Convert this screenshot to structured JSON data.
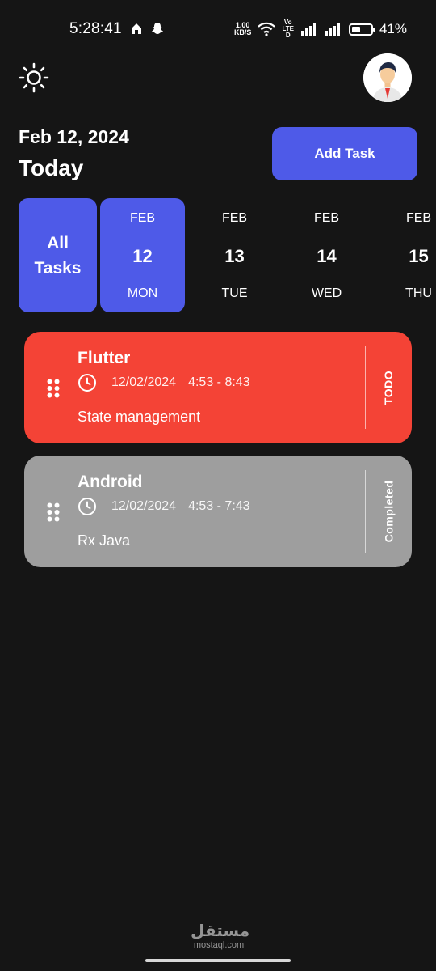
{
  "status_bar": {
    "time": "5:28:41",
    "net_speed_value": "1.00",
    "net_speed_unit": "KB/S",
    "volte_top": "Vo",
    "volte_mid": "LTE",
    "volte_bot": "D",
    "battery_percent": "41%",
    "battery_level": 0.41
  },
  "header": {
    "date": "Feb 12, 2024",
    "today": "Today",
    "add_task_label": "Add Task"
  },
  "date_strip": {
    "all_tasks_line1": "All",
    "all_tasks_line2": "Tasks",
    "days": [
      {
        "month": "FEB",
        "day": "12",
        "weekday": "MON",
        "selected": true
      },
      {
        "month": "FEB",
        "day": "13",
        "weekday": "TUE",
        "selected": false
      },
      {
        "month": "FEB",
        "day": "14",
        "weekday": "WED",
        "selected": false
      },
      {
        "month": "FEB",
        "day": "15",
        "weekday": "THU",
        "selected": false
      }
    ]
  },
  "tasks": [
    {
      "title": "Flutter",
      "date": "12/02/2024",
      "time_range": "4:53 - 8:43",
      "description": "State management",
      "status": "TODO",
      "color": "#f44336"
    },
    {
      "title": "Android",
      "date": "12/02/2024",
      "time_range": "4:53 - 7:43",
      "description": "Rx Java",
      "status": "Completed",
      "color": "#9e9e9e"
    }
  ],
  "watermark": {
    "arabic": "مستقل",
    "latin": "mostaql.com"
  },
  "colors": {
    "background": "#151515",
    "accent": "#4e5ae8",
    "todo": "#f44336",
    "completed": "#9e9e9e"
  },
  "icons": {
    "theme_toggle": "sun-icon",
    "drag_handle": "drag-dots-icon",
    "time": "clock-icon"
  }
}
